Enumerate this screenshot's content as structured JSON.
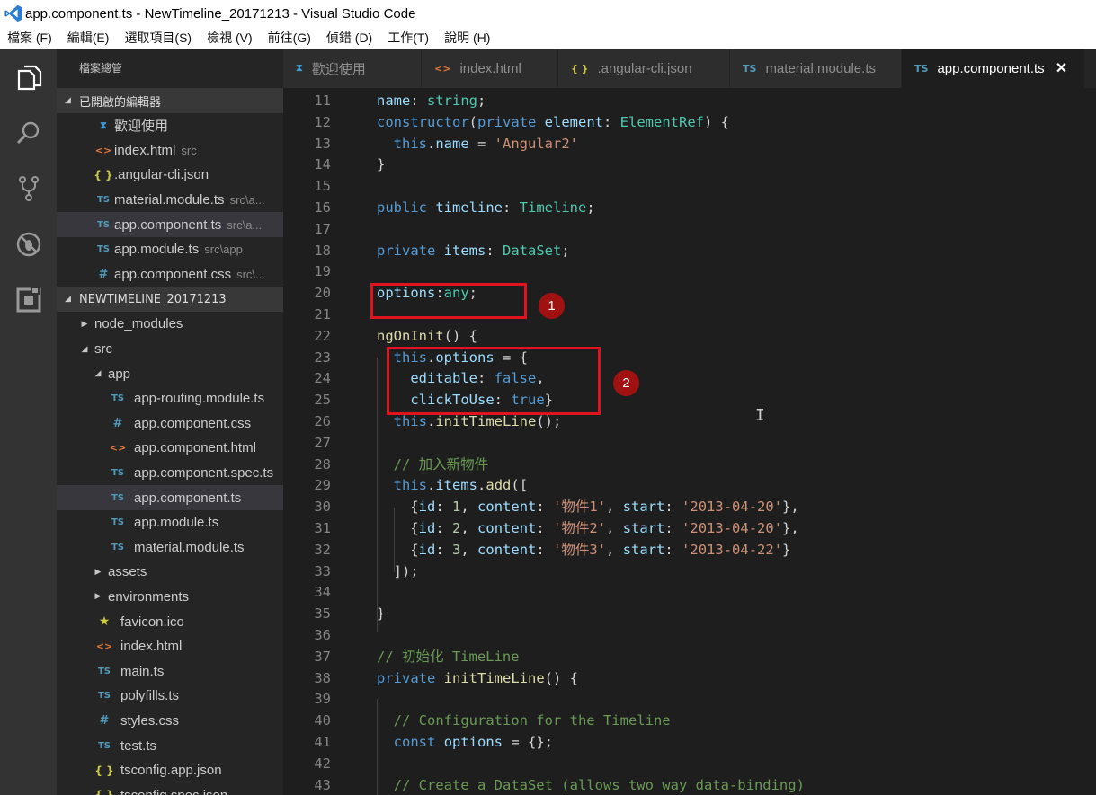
{
  "window": {
    "title": "app.component.ts - NewTimeline_20171213 - Visual Studio Code"
  },
  "menu": [
    "檔案 (F)",
    "編輯(E)",
    "選取項目(S)",
    "檢視 (V)",
    "前往(G)",
    "偵錯 (D)",
    "工作(T)",
    "說明 (H)"
  ],
  "activity_bar": [
    {
      "name": "explorer-icon"
    },
    {
      "name": "search-icon"
    },
    {
      "name": "source-control-icon"
    },
    {
      "name": "debug-icon"
    },
    {
      "name": "extensions-icon"
    }
  ],
  "sidebar": {
    "title": "檔案總管",
    "open_editors": {
      "header": "已開啟的編輯器",
      "items": [
        {
          "icon": "vs",
          "label": "歡迎使用",
          "desc": ""
        },
        {
          "icon": "html",
          "label": "index.html",
          "desc": "src"
        },
        {
          "icon": "json",
          "label": ".angular-cli.json",
          "desc": ""
        },
        {
          "icon": "ts",
          "label": "material.module.ts",
          "desc": "src\\a..."
        },
        {
          "icon": "ts",
          "label": "app.component.ts",
          "desc": "src\\a...",
          "selected": true
        },
        {
          "icon": "ts",
          "label": "app.module.ts",
          "desc": "src\\app"
        },
        {
          "icon": "css",
          "label": "app.component.css",
          "desc": "src\\..."
        }
      ]
    },
    "project": {
      "header": "NEWTIMELINE_20171213",
      "tree": [
        {
          "type": "folder",
          "open": false,
          "label": "node_modules",
          "depth": 0
        },
        {
          "type": "folder",
          "open": true,
          "label": "src",
          "depth": 0
        },
        {
          "type": "folder",
          "open": true,
          "label": "app",
          "depth": 1
        },
        {
          "icon": "ts",
          "label": "app-routing.module.ts",
          "depth": 2
        },
        {
          "icon": "css",
          "label": "app.component.css",
          "depth": 2
        },
        {
          "icon": "html",
          "label": "app.component.html",
          "depth": 2
        },
        {
          "icon": "ts",
          "label": "app.component.spec.ts",
          "depth": 2
        },
        {
          "icon": "ts",
          "label": "app.component.ts",
          "depth": 2,
          "selected": true
        },
        {
          "icon": "ts",
          "label": "app.module.ts",
          "depth": 2
        },
        {
          "icon": "ts",
          "label": "material.module.ts",
          "depth": 2
        },
        {
          "type": "folder",
          "open": false,
          "label": "assets",
          "depth": 1
        },
        {
          "type": "folder",
          "open": false,
          "label": "environments",
          "depth": 1
        },
        {
          "icon": "star",
          "label": "favicon.ico",
          "depth": 1
        },
        {
          "icon": "html",
          "label": "index.html",
          "depth": 1
        },
        {
          "icon": "ts",
          "label": "main.ts",
          "depth": 1
        },
        {
          "icon": "ts",
          "label": "polyfills.ts",
          "depth": 1
        },
        {
          "icon": "css",
          "label": "styles.css",
          "depth": 1
        },
        {
          "icon": "ts",
          "label": "test.ts",
          "depth": 1
        },
        {
          "icon": "json",
          "label": "tsconfig.app.json",
          "depth": 1
        },
        {
          "icon": "json",
          "label": "tsconfig.spec.json",
          "depth": 1
        }
      ]
    }
  },
  "tabs": [
    {
      "icon": "vs",
      "label": "歡迎使用",
      "active": false
    },
    {
      "icon": "html",
      "label": "index.html",
      "active": false
    },
    {
      "icon": "json",
      "label": ".angular-cli.json",
      "active": false
    },
    {
      "icon": "ts",
      "label": "material.module.ts",
      "active": false
    },
    {
      "icon": "ts",
      "label": "app.component.ts",
      "active": true
    }
  ],
  "icon_glyphs": {
    "vs": "⧗",
    "html": "<>",
    "json": "{ }",
    "ts": "TS",
    "css": "#",
    "star": "★"
  },
  "close_glyph": "✕",
  "editor": {
    "lines": [
      {
        "n": "11",
        "tokens": [
          [
            "v",
            "name"
          ],
          [
            "p",
            ": "
          ],
          [
            "t",
            "string"
          ],
          [
            "p",
            ";"
          ]
        ]
      },
      {
        "n": "12",
        "tokens": [
          [
            "k",
            "constructor"
          ],
          [
            "p",
            "("
          ],
          [
            "k",
            "private"
          ],
          [
            "p",
            " "
          ],
          [
            "v",
            "element"
          ],
          [
            "p",
            ": "
          ],
          [
            "t",
            "ElementRef"
          ],
          [
            "p",
            ") {"
          ]
        ]
      },
      {
        "n": "13",
        "tokens": [
          [
            "p",
            "  "
          ],
          [
            "k",
            "this"
          ],
          [
            "p",
            "."
          ],
          [
            "v",
            "name"
          ],
          [
            "p",
            " = "
          ],
          [
            "s",
            "'Angular2'"
          ]
        ]
      },
      {
        "n": "14",
        "tokens": [
          [
            "p",
            "}"
          ]
        ]
      },
      {
        "n": "15",
        "tokens": []
      },
      {
        "n": "16",
        "tokens": [
          [
            "k",
            "public"
          ],
          [
            "p",
            " "
          ],
          [
            "v",
            "timeline"
          ],
          [
            "p",
            ": "
          ],
          [
            "t",
            "Timeline"
          ],
          [
            "p",
            ";"
          ]
        ]
      },
      {
        "n": "17",
        "tokens": []
      },
      {
        "n": "18",
        "tokens": [
          [
            "k",
            "private"
          ],
          [
            "p",
            " "
          ],
          [
            "v",
            "items"
          ],
          [
            "p",
            ": "
          ],
          [
            "t",
            "DataSet"
          ],
          [
            "p",
            ";"
          ]
        ]
      },
      {
        "n": "19",
        "tokens": []
      },
      {
        "n": "20",
        "tokens": [
          [
            "v",
            "options"
          ],
          [
            "p",
            ":"
          ],
          [
            "t",
            "any"
          ],
          [
            "p",
            ";"
          ]
        ]
      },
      {
        "n": "21",
        "tokens": []
      },
      {
        "n": "22",
        "tokens": [
          [
            "f",
            "ngOnInit"
          ],
          [
            "p",
            "() {"
          ]
        ]
      },
      {
        "n": "23",
        "tokens": [
          [
            "p",
            "  "
          ],
          [
            "k",
            "this"
          ],
          [
            "p",
            "."
          ],
          [
            "v",
            "options"
          ],
          [
            "p",
            " = {"
          ]
        ]
      },
      {
        "n": "24",
        "tokens": [
          [
            "p",
            "    "
          ],
          [
            "v",
            "editable"
          ],
          [
            "p",
            ": "
          ],
          [
            "k",
            "false"
          ],
          [
            "p",
            ","
          ]
        ]
      },
      {
        "n": "25",
        "tokens": [
          [
            "p",
            "    "
          ],
          [
            "v",
            "clickToUse"
          ],
          [
            "p",
            ": "
          ],
          [
            "k",
            "true"
          ],
          [
            "p",
            "}"
          ]
        ]
      },
      {
        "n": "26",
        "tokens": [
          [
            "p",
            "  "
          ],
          [
            "k",
            "this"
          ],
          [
            "p",
            "."
          ],
          [
            "f",
            "initTimeLine"
          ],
          [
            "p",
            "();"
          ]
        ]
      },
      {
        "n": "27",
        "tokens": []
      },
      {
        "n": "28",
        "tokens": [
          [
            "p",
            "  "
          ],
          [
            "c",
            "// 加入新物件"
          ]
        ]
      },
      {
        "n": "29",
        "tokens": [
          [
            "p",
            "  "
          ],
          [
            "k",
            "this"
          ],
          [
            "p",
            "."
          ],
          [
            "v",
            "items"
          ],
          [
            "p",
            "."
          ],
          [
            "f",
            "add"
          ],
          [
            "p",
            "(["
          ]
        ]
      },
      {
        "n": "30",
        "tokens": [
          [
            "p",
            "    {"
          ],
          [
            "v",
            "id"
          ],
          [
            "p",
            ": "
          ],
          [
            "n",
            "1"
          ],
          [
            "p",
            ", "
          ],
          [
            "v",
            "content"
          ],
          [
            "p",
            ": "
          ],
          [
            "s",
            "'物件1'"
          ],
          [
            "p",
            ", "
          ],
          [
            "v",
            "start"
          ],
          [
            "p",
            ": "
          ],
          [
            "s",
            "'2013-04-20'"
          ],
          [
            "p",
            "},"
          ]
        ]
      },
      {
        "n": "31",
        "tokens": [
          [
            "p",
            "    {"
          ],
          [
            "v",
            "id"
          ],
          [
            "p",
            ": "
          ],
          [
            "n",
            "2"
          ],
          [
            "p",
            ", "
          ],
          [
            "v",
            "content"
          ],
          [
            "p",
            ": "
          ],
          [
            "s",
            "'物件2'"
          ],
          [
            "p",
            ", "
          ],
          [
            "v",
            "start"
          ],
          [
            "p",
            ": "
          ],
          [
            "s",
            "'2013-04-20'"
          ],
          [
            "p",
            "},"
          ]
        ]
      },
      {
        "n": "32",
        "tokens": [
          [
            "p",
            "    {"
          ],
          [
            "v",
            "id"
          ],
          [
            "p",
            ": "
          ],
          [
            "n",
            "3"
          ],
          [
            "p",
            ", "
          ],
          [
            "v",
            "content"
          ],
          [
            "p",
            ": "
          ],
          [
            "s",
            "'物件3'"
          ],
          [
            "p",
            ", "
          ],
          [
            "v",
            "start"
          ],
          [
            "p",
            ": "
          ],
          [
            "s",
            "'2013-04-22'"
          ],
          [
            "p",
            "}"
          ]
        ]
      },
      {
        "n": "33",
        "tokens": [
          [
            "p",
            "  ]);"
          ]
        ]
      },
      {
        "n": "34",
        "tokens": []
      },
      {
        "n": "35",
        "tokens": [
          [
            "p",
            "}"
          ]
        ]
      },
      {
        "n": "36",
        "tokens": []
      },
      {
        "n": "37",
        "tokens": [
          [
            "c",
            "// 初始化 TimeLine"
          ]
        ]
      },
      {
        "n": "38",
        "tokens": [
          [
            "k",
            "private"
          ],
          [
            "p",
            " "
          ],
          [
            "f",
            "initTimeLine"
          ],
          [
            "p",
            "() {"
          ]
        ]
      },
      {
        "n": "39",
        "tokens": []
      },
      {
        "n": "40",
        "tokens": [
          [
            "p",
            "  "
          ],
          [
            "c",
            "// Configuration for the Timeline"
          ]
        ]
      },
      {
        "n": "41",
        "tokens": [
          [
            "p",
            "  "
          ],
          [
            "k",
            "const"
          ],
          [
            "p",
            " "
          ],
          [
            "v",
            "options"
          ],
          [
            "p",
            " = {};"
          ]
        ]
      },
      {
        "n": "42",
        "tokens": []
      },
      {
        "n": "43",
        "tokens": [
          [
            "p",
            "  "
          ],
          [
            "c",
            "// Create a DataSet (allows two way data-binding)"
          ]
        ]
      }
    ]
  },
  "annotations": [
    {
      "label": "1"
    },
    {
      "label": "2"
    }
  ]
}
